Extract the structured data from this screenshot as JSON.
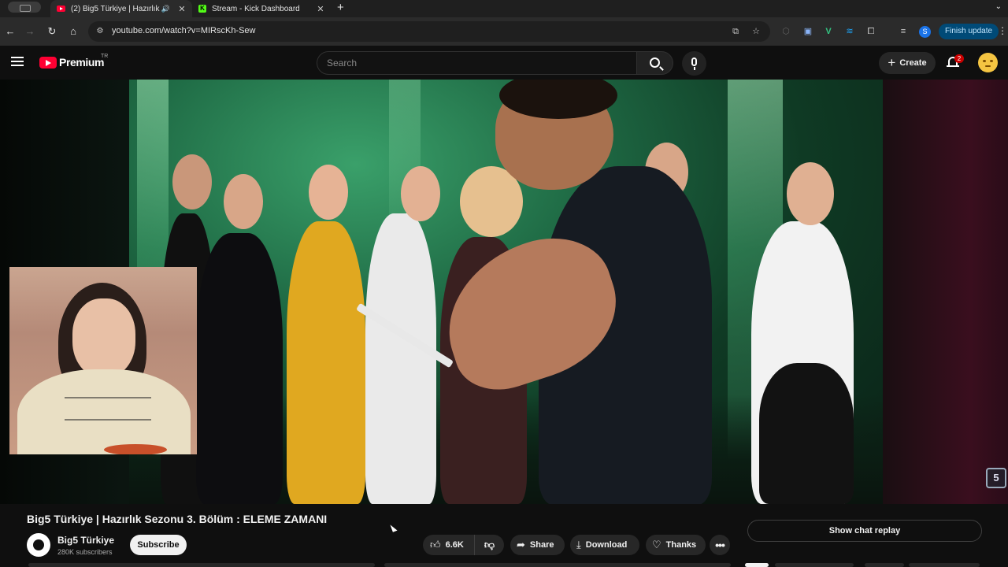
{
  "browser": {
    "tabs": [
      {
        "title": "(2) Big5 Türkiye | Hazırlık",
        "active": true
      },
      {
        "title": "Stream - Kick Dashboard",
        "active": false
      }
    ],
    "new_tab": "+",
    "url": "youtube.com/watch?v=MIRscKh-Sew",
    "profile_initial": "S",
    "finish_update_label": "Finish update"
  },
  "masthead": {
    "logo_text": "Premium",
    "region": "TR",
    "search_placeholder": "Search",
    "create_label": "Create",
    "notification_count": "2"
  },
  "video": {
    "title": "Big5 Türkiye | Hazırlık Sezonu 3. Bölüm : ELEME ZAMANI",
    "channel_name": "Big5 Türkiye",
    "subscribers": "280K subscribers",
    "subscribe_label": "Subscribe",
    "watermark": "5"
  },
  "actions": {
    "likes": "6.6K",
    "share_label": "Share",
    "download_label": "Download",
    "thanks_label": "Thanks",
    "more_label": "•••"
  },
  "chat": {
    "show_replay_label": "Show chat replay"
  },
  "colors": {
    "brand_red": "#ff0033",
    "background": "#0f0f0f",
    "update_button": "#004a77"
  }
}
